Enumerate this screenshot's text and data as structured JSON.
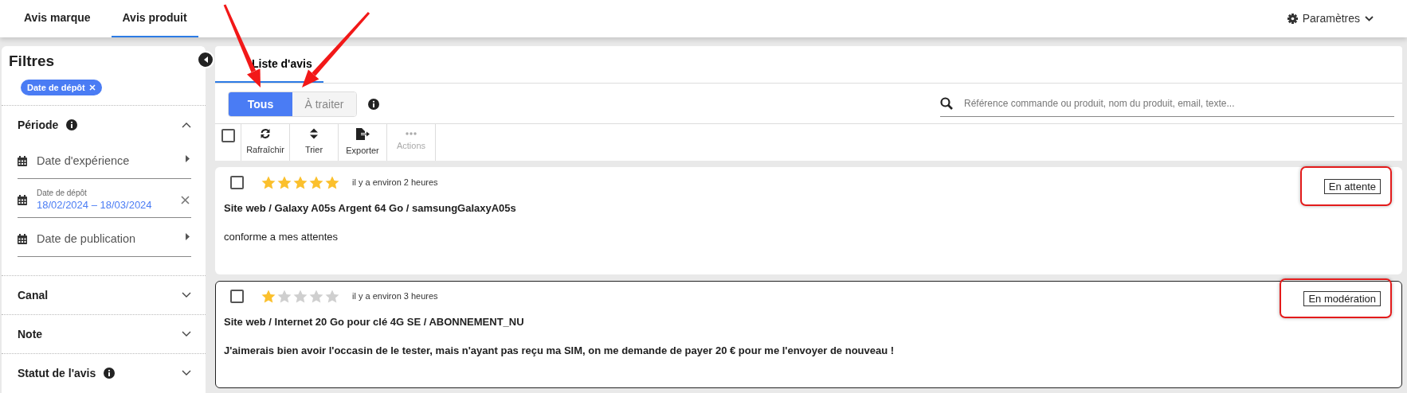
{
  "top_tabs": [
    {
      "label": "Avis marque",
      "selected": false
    },
    {
      "label": "Avis produit",
      "selected": true
    }
  ],
  "settings_menu": {
    "label": "Paramètres"
  },
  "sidebar": {
    "title": "Filtres",
    "active_filters": [
      {
        "label": "Date de dépôt"
      }
    ],
    "sections": [
      {
        "title": "Période",
        "info": true,
        "expanded": true,
        "fields": [
          {
            "label": "Date d'expérience"
          },
          {
            "label": "Date de dépôt",
            "value": "18/02/2024 – 18/03/2024"
          },
          {
            "label": "Date de publication"
          }
        ]
      },
      {
        "title": "Canal",
        "info": false,
        "expanded": false
      },
      {
        "title": "Note",
        "info": false,
        "expanded": false
      },
      {
        "title": "Statut de l'avis",
        "info": true,
        "expanded": false
      }
    ]
  },
  "main_tabs": [
    {
      "label": "Liste d'avis",
      "selected": true
    }
  ],
  "filter_toggle": [
    {
      "label": "Tous",
      "selected": true,
      "arrow": true
    },
    {
      "label": "À traiter",
      "selected": false,
      "arrow": true
    }
  ],
  "search": {
    "placeholder": "Référence commande ou produit, nom du produit, email, texte..."
  },
  "toolbar": {
    "select_all_checked": false,
    "actions": [
      {
        "label": "Rafraîchir",
        "kind": "refresh",
        "disabled": false
      },
      {
        "label": "Trier",
        "kind": "sort",
        "disabled": false
      },
      {
        "label": "Exporter",
        "kind": "export",
        "disabled": false
      },
      {
        "label": "Actions",
        "kind": "more",
        "disabled": true
      }
    ]
  },
  "reviews": [
    {
      "checked": false,
      "selected": false,
      "stars": 5,
      "time": "il y a environ 2 heures",
      "title": "Site web / Galaxy A05s Argent 64 Go / samsungGalaxyA05s",
      "text": "conforme a mes attentes",
      "unread": false,
      "status": "En attente",
      "status_highlighted": true
    },
    {
      "checked": false,
      "selected": true,
      "stars": 1,
      "time": "il y a environ 3 heures",
      "title": "Site web / Internet 20 Go pour clé 4G SE / ABONNEMENT_NU",
      "text": "J'aimerais bien avoir l'occasin de le tester, mais n'ayant pas reçu ma SIM, on me demande de payer 20 € pour me l'envoyer de nouveau !",
      "unread": true,
      "status": "En modération",
      "status_highlighted": true
    }
  ]
}
